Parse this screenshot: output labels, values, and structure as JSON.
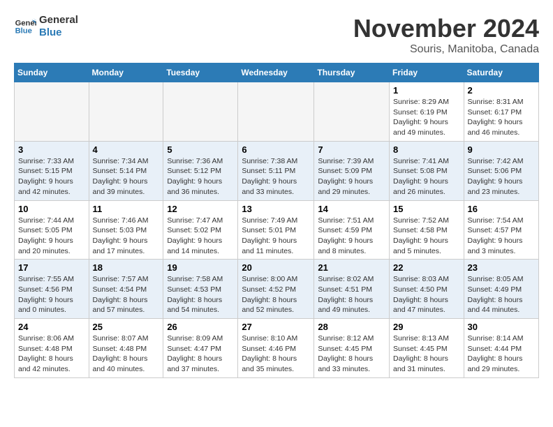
{
  "logo": {
    "line1": "General",
    "line2": "Blue"
  },
  "title": "November 2024",
  "location": "Souris, Manitoba, Canada",
  "weekdays": [
    "Sunday",
    "Monday",
    "Tuesday",
    "Wednesday",
    "Thursday",
    "Friday",
    "Saturday"
  ],
  "weeks": [
    [
      {
        "day": "",
        "info": ""
      },
      {
        "day": "",
        "info": ""
      },
      {
        "day": "",
        "info": ""
      },
      {
        "day": "",
        "info": ""
      },
      {
        "day": "",
        "info": ""
      },
      {
        "day": "1",
        "info": "Sunrise: 8:29 AM\nSunset: 6:19 PM\nDaylight: 9 hours and 49 minutes."
      },
      {
        "day": "2",
        "info": "Sunrise: 8:31 AM\nSunset: 6:17 PM\nDaylight: 9 hours and 46 minutes."
      }
    ],
    [
      {
        "day": "3",
        "info": "Sunrise: 7:33 AM\nSunset: 5:15 PM\nDaylight: 9 hours and 42 minutes."
      },
      {
        "day": "4",
        "info": "Sunrise: 7:34 AM\nSunset: 5:14 PM\nDaylight: 9 hours and 39 minutes."
      },
      {
        "day": "5",
        "info": "Sunrise: 7:36 AM\nSunset: 5:12 PM\nDaylight: 9 hours and 36 minutes."
      },
      {
        "day": "6",
        "info": "Sunrise: 7:38 AM\nSunset: 5:11 PM\nDaylight: 9 hours and 33 minutes."
      },
      {
        "day": "7",
        "info": "Sunrise: 7:39 AM\nSunset: 5:09 PM\nDaylight: 9 hours and 29 minutes."
      },
      {
        "day": "8",
        "info": "Sunrise: 7:41 AM\nSunset: 5:08 PM\nDaylight: 9 hours and 26 minutes."
      },
      {
        "day": "9",
        "info": "Sunrise: 7:42 AM\nSunset: 5:06 PM\nDaylight: 9 hours and 23 minutes."
      }
    ],
    [
      {
        "day": "10",
        "info": "Sunrise: 7:44 AM\nSunset: 5:05 PM\nDaylight: 9 hours and 20 minutes."
      },
      {
        "day": "11",
        "info": "Sunrise: 7:46 AM\nSunset: 5:03 PM\nDaylight: 9 hours and 17 minutes."
      },
      {
        "day": "12",
        "info": "Sunrise: 7:47 AM\nSunset: 5:02 PM\nDaylight: 9 hours and 14 minutes."
      },
      {
        "day": "13",
        "info": "Sunrise: 7:49 AM\nSunset: 5:01 PM\nDaylight: 9 hours and 11 minutes."
      },
      {
        "day": "14",
        "info": "Sunrise: 7:51 AM\nSunset: 4:59 PM\nDaylight: 9 hours and 8 minutes."
      },
      {
        "day": "15",
        "info": "Sunrise: 7:52 AM\nSunset: 4:58 PM\nDaylight: 9 hours and 5 minutes."
      },
      {
        "day": "16",
        "info": "Sunrise: 7:54 AM\nSunset: 4:57 PM\nDaylight: 9 hours and 3 minutes."
      }
    ],
    [
      {
        "day": "17",
        "info": "Sunrise: 7:55 AM\nSunset: 4:56 PM\nDaylight: 9 hours and 0 minutes."
      },
      {
        "day": "18",
        "info": "Sunrise: 7:57 AM\nSunset: 4:54 PM\nDaylight: 8 hours and 57 minutes."
      },
      {
        "day": "19",
        "info": "Sunrise: 7:58 AM\nSunset: 4:53 PM\nDaylight: 8 hours and 54 minutes."
      },
      {
        "day": "20",
        "info": "Sunrise: 8:00 AM\nSunset: 4:52 PM\nDaylight: 8 hours and 52 minutes."
      },
      {
        "day": "21",
        "info": "Sunrise: 8:02 AM\nSunset: 4:51 PM\nDaylight: 8 hours and 49 minutes."
      },
      {
        "day": "22",
        "info": "Sunrise: 8:03 AM\nSunset: 4:50 PM\nDaylight: 8 hours and 47 minutes."
      },
      {
        "day": "23",
        "info": "Sunrise: 8:05 AM\nSunset: 4:49 PM\nDaylight: 8 hours and 44 minutes."
      }
    ],
    [
      {
        "day": "24",
        "info": "Sunrise: 8:06 AM\nSunset: 4:48 PM\nDaylight: 8 hours and 42 minutes."
      },
      {
        "day": "25",
        "info": "Sunrise: 8:07 AM\nSunset: 4:48 PM\nDaylight: 8 hours and 40 minutes."
      },
      {
        "day": "26",
        "info": "Sunrise: 8:09 AM\nSunset: 4:47 PM\nDaylight: 8 hours and 37 minutes."
      },
      {
        "day": "27",
        "info": "Sunrise: 8:10 AM\nSunset: 4:46 PM\nDaylight: 8 hours and 35 minutes."
      },
      {
        "day": "28",
        "info": "Sunrise: 8:12 AM\nSunset: 4:45 PM\nDaylight: 8 hours and 33 minutes."
      },
      {
        "day": "29",
        "info": "Sunrise: 8:13 AM\nSunset: 4:45 PM\nDaylight: 8 hours and 31 minutes."
      },
      {
        "day": "30",
        "info": "Sunrise: 8:14 AM\nSunset: 4:44 PM\nDaylight: 8 hours and 29 minutes."
      }
    ]
  ]
}
